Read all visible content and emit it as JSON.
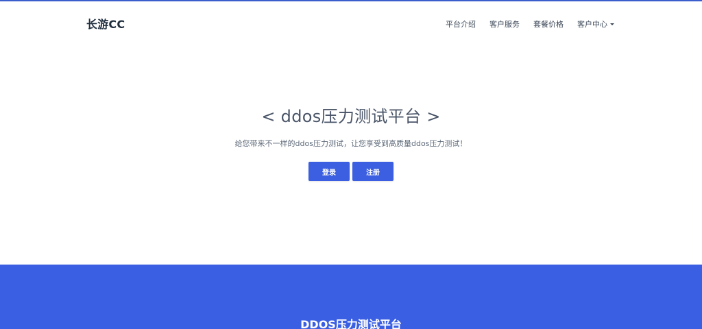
{
  "header": {
    "brand": "长游CC",
    "nav": [
      {
        "label": "平台介绍"
      },
      {
        "label": "客户服务"
      },
      {
        "label": "套餐价格"
      },
      {
        "label": "客户中心"
      }
    ]
  },
  "hero": {
    "title": "< ddos压力测试平台 >",
    "subtitle": "给您带来不一样的ddos压力测试，让您享受到高质量ddos压力测试！",
    "login_label": "登录",
    "register_label": "注册"
  },
  "section": {
    "title": "DDOS压力测试平台"
  },
  "colors": {
    "accent": "#3a5fe2",
    "text": "#4a5568"
  }
}
